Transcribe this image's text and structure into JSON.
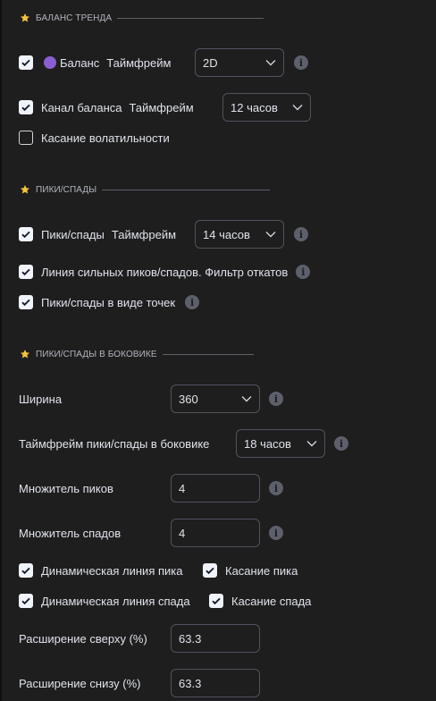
{
  "sections": {
    "trend_balance": "БАЛАНС ТРЕНДА",
    "peaks": "ПИКИ/СПАДЫ",
    "sideways": "ПИКИ/СПАДЫ В БОКОВИКЕ"
  },
  "balance": {
    "label": "Баланс",
    "timeframe_label": "Таймфрейм",
    "timeframe_value": "2D",
    "checked": true
  },
  "balance_channel": {
    "label": "Канал баланса",
    "timeframe_label": "Таймфрейм",
    "timeframe_value": "12 часов",
    "checked": true
  },
  "volatility_touch": {
    "label": "Касание волатильности",
    "checked": false
  },
  "peaks": {
    "label": "Пики/спады",
    "timeframe_label": "Таймфрейм",
    "timeframe_value": "14 часов",
    "checked": true
  },
  "strong_line": {
    "label": "Линия сильных пиков/спадов. Фильтр откатов",
    "checked": true
  },
  "dots": {
    "label": "Пики/спады в виде точек",
    "checked": true
  },
  "width": {
    "label": "Ширина",
    "value": "360"
  },
  "sideways_tf": {
    "label": "Таймфрейм пики/спады в боковике",
    "value": "18 часов"
  },
  "peak_mult": {
    "label": "Множитель пиков",
    "value": "4"
  },
  "dip_mult": {
    "label": "Множитель спадов",
    "value": "4"
  },
  "dyn_peak": {
    "label": "Динамическая линия пика",
    "checked": true
  },
  "peak_touch": {
    "label": "Касание пика",
    "checked": true
  },
  "dyn_dip": {
    "label": "Динамическая линия спада",
    "checked": true
  },
  "dip_touch": {
    "label": "Касание спада",
    "checked": true
  },
  "ext_top": {
    "label": "Расширение сверху (%)",
    "value": "63.3"
  },
  "ext_bottom": {
    "label": "Расширение снизу (%)",
    "value": "63.3"
  },
  "info_glyph": "i"
}
